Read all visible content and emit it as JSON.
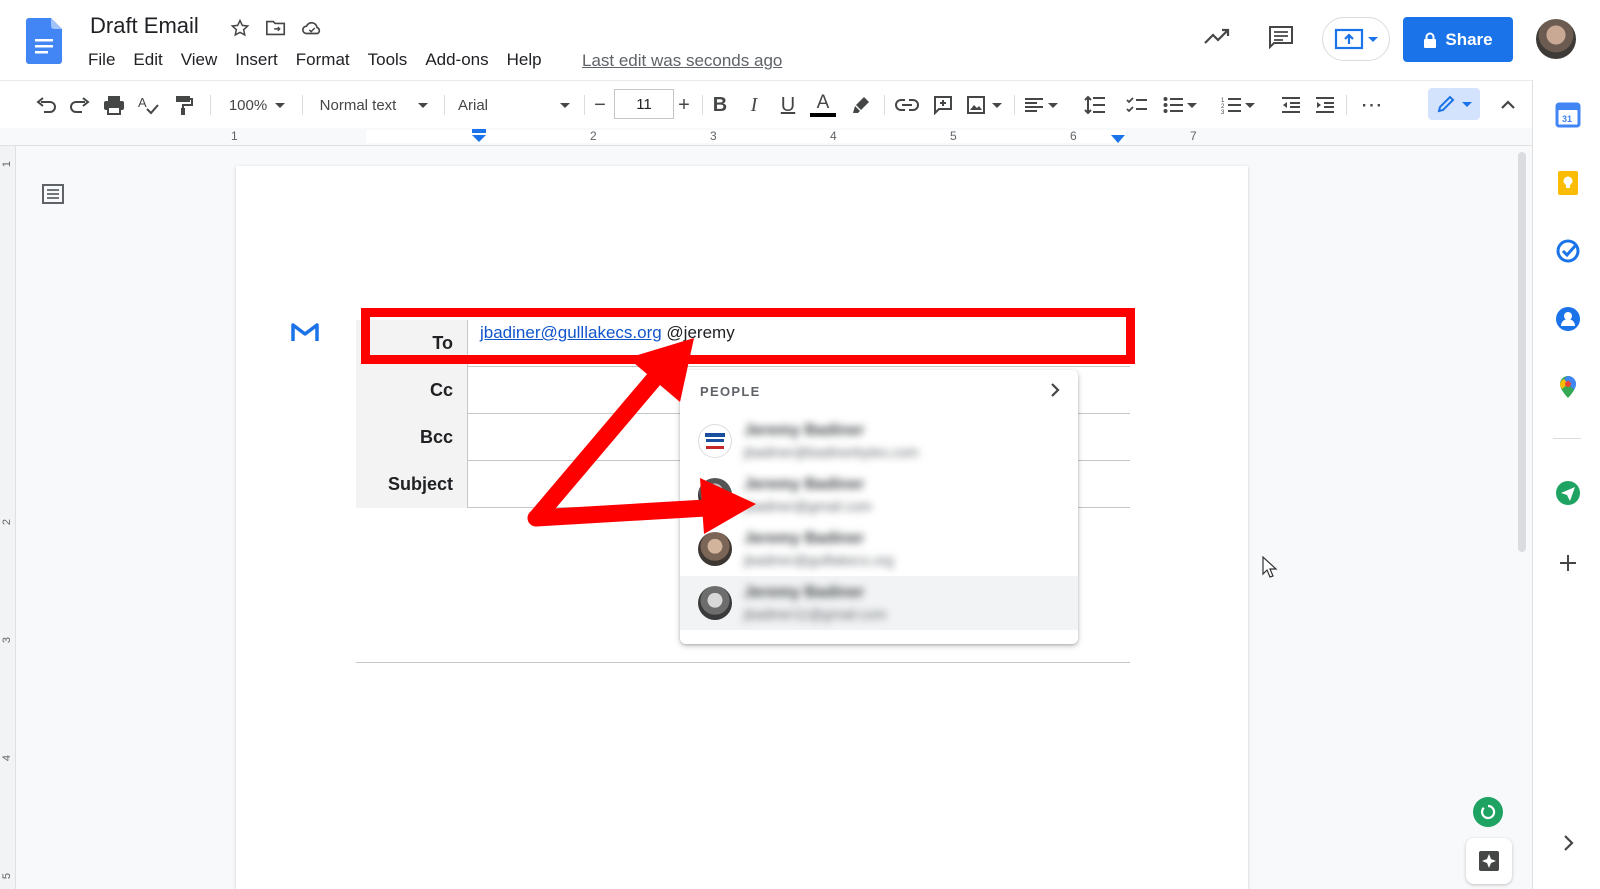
{
  "doc": {
    "title": "Draft Email",
    "last_edit": "Last edit was seconds ago"
  },
  "menu": [
    "File",
    "Edit",
    "View",
    "Insert",
    "Format",
    "Tools",
    "Add-ons",
    "Help"
  ],
  "header": {
    "share_label": "Share"
  },
  "toolbar": {
    "zoom": "100%",
    "style": "Normal text",
    "font": "Arial",
    "font_size": "11"
  },
  "ruler": {
    "h_numbers": [
      "1",
      "2",
      "3",
      "4",
      "5",
      "6",
      "7"
    ],
    "v_numbers": [
      "1",
      "2",
      "3",
      "4",
      "5"
    ]
  },
  "email_draft": {
    "to_label": "To",
    "cc_label": "Cc",
    "bcc_label": "Bcc",
    "subject_label": "Subject",
    "to_link": "jbadiner@gulllakecs.org",
    "to_typing": "@jeremy"
  },
  "people_dropdown": {
    "heading": "PEOPLE",
    "people": [
      {
        "name": "Jeremy Badiner",
        "email": "jbadiner@badinerbytes.com"
      },
      {
        "name": "Jeremy Badiner",
        "email": "jbadiner@gmail.com"
      },
      {
        "name": "Jeremy Badiner",
        "email": "jbadiner@gulllakecs.org"
      },
      {
        "name": "Jeremy Badiner",
        "email": "jbadiner11@gmail.com"
      }
    ]
  },
  "colors": {
    "accent": "#1a73e8",
    "annotation": "#ff0000",
    "docs_blue": "#4285f4"
  }
}
